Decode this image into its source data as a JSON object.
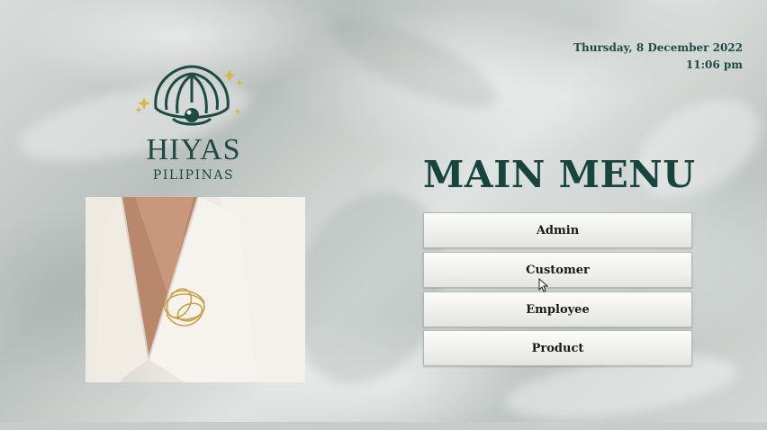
{
  "header": {
    "date": "Thursday, 8 December 2022",
    "time": "11:06 pm"
  },
  "logo": {
    "name": "HIYAS",
    "subtitle": "PILIPINAS",
    "icon": "pearl-shell-icon"
  },
  "main": {
    "title": "MAIN MENU",
    "buttons": [
      {
        "label": "Admin"
      },
      {
        "label": "Customer"
      },
      {
        "label": "Employee"
      },
      {
        "label": "Product"
      }
    ]
  },
  "colors": {
    "accent": "#17453d",
    "gold": "#d8b54a"
  }
}
